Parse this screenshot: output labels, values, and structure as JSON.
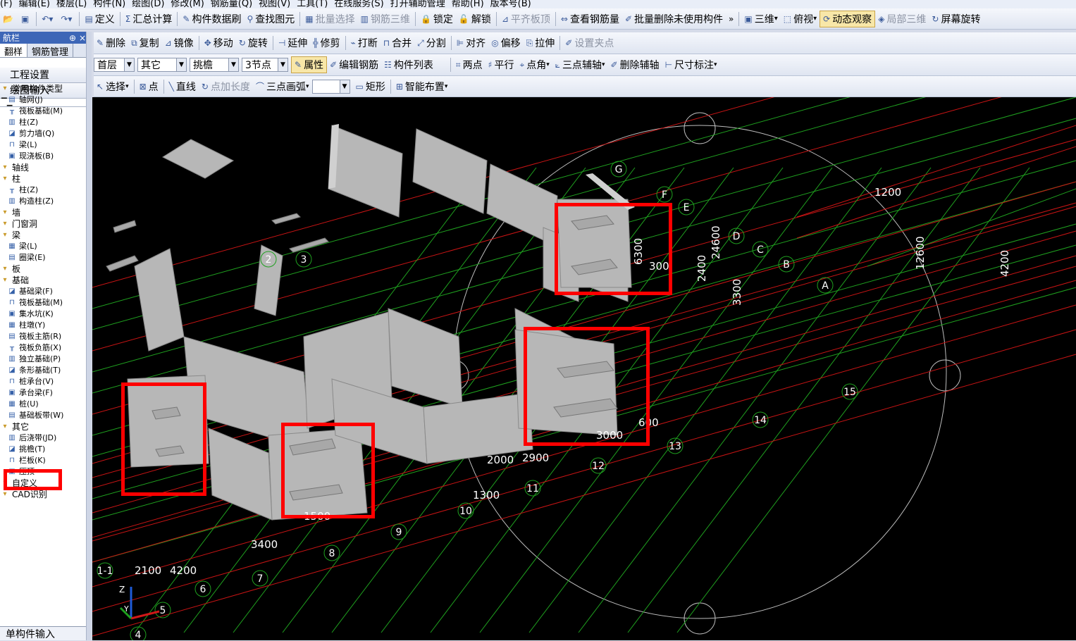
{
  "menu": [
    "(F)",
    "编辑(E)",
    "楼层(L)",
    "构件(N)",
    "绘图(D)",
    "修改(M)",
    "钢筋量(Q)",
    "视图(V)",
    "工具(T)",
    "在线服务(S)",
    "打开辅助管理",
    "帮助(H)",
    "版本号(B)"
  ],
  "toolbar1": {
    "items": [
      {
        "label": "定义",
        "icon": "define-icon"
      },
      {
        "label": "汇总计算",
        "icon": "sigma-icon"
      },
      {
        "label": "构件数据刷",
        "icon": "brush-icon"
      },
      {
        "label": "查找图元",
        "icon": "binoculars-icon"
      },
      {
        "label": "批量选择",
        "icon": "batch-select-icon",
        "disabled": true
      },
      {
        "label": "钢筋三维",
        "icon": "rebar-3d-icon",
        "disabled": true
      },
      {
        "label": "锁定",
        "icon": "lock-icon"
      },
      {
        "label": "解锁",
        "icon": "unlock-icon"
      },
      {
        "label": "平齐板顶",
        "icon": "align-top-icon",
        "disabled": true
      },
      {
        "label": "查看钢筋量",
        "icon": "view-rebar-icon"
      },
      {
        "label": "批量删除未使用构件",
        "icon": "batch-delete-icon"
      }
    ],
    "view_items": [
      {
        "label": "三维",
        "icon": "cube-icon"
      },
      {
        "label": "俯视",
        "icon": "topview-icon"
      },
      {
        "label": "动态观察",
        "icon": "orbit-icon",
        "active": true
      },
      {
        "label": "局部三维",
        "icon": "local-3d-icon",
        "disabled": true
      },
      {
        "label": "屏幕旋转",
        "icon": "rotate-screen-icon"
      }
    ]
  },
  "toolbar2": [
    {
      "label": "删除",
      "icon": "delete-icon"
    },
    {
      "label": "复制",
      "icon": "copy-icon"
    },
    {
      "label": "镜像",
      "icon": "mirror-icon"
    },
    {
      "label": "移动",
      "icon": "move-icon"
    },
    {
      "label": "旋转",
      "icon": "rotate-icon"
    },
    {
      "label": "延伸",
      "icon": "extend-icon"
    },
    {
      "label": "修剪",
      "icon": "trim-icon"
    },
    {
      "label": "打断",
      "icon": "break-icon"
    },
    {
      "label": "合并",
      "icon": "merge-icon"
    },
    {
      "label": "分割",
      "icon": "split-icon"
    },
    {
      "label": "对齐",
      "icon": "align-icon"
    },
    {
      "label": "偏移",
      "icon": "offset-icon"
    },
    {
      "label": "拉伸",
      "icon": "stretch-icon"
    },
    {
      "label": "设置夹点",
      "icon": "grip-icon",
      "disabled": true
    }
  ],
  "toolbar3": {
    "floor": "首层",
    "category": "其它",
    "component": "挑檐",
    "node": "3节点",
    "buttons": [
      "属性",
      "编辑钢筋",
      "构件列表"
    ],
    "axis_tools": [
      "两点",
      "平行",
      "点角",
      "三点辅轴",
      "删除辅轴",
      "尺寸标注"
    ]
  },
  "toolbar4": [
    "选择",
    "点",
    "直线",
    "点加长度",
    "三点画弧",
    "矩形",
    "智能布置"
  ],
  "sidebar": {
    "title": "航栏",
    "pin": "⊕",
    "close": "×",
    "tabs": [
      "翻样",
      "钢筋管理"
    ],
    "buttons": [
      "工程设置",
      "绘图输入"
    ],
    "tree": [
      {
        "label": "常用构件类型",
        "cat": true,
        "lvl": 1
      },
      {
        "label": "轴网(J)",
        "lvl": 2
      },
      {
        "label": "筏板基础(M)",
        "lvl": 2
      },
      {
        "label": "柱(Z)",
        "lvl": 2
      },
      {
        "label": "剪力墙(Q)",
        "lvl": 2
      },
      {
        "label": "梁(L)",
        "lvl": 2
      },
      {
        "label": "现浇板(B)",
        "lvl": 2
      },
      {
        "label": "轴线",
        "cat": true,
        "lvl": 1
      },
      {
        "label": "柱",
        "cat": true,
        "lvl": 1
      },
      {
        "label": "柱(Z)",
        "lvl": 2
      },
      {
        "label": "构造柱(Z)",
        "lvl": 2
      },
      {
        "label": "墙",
        "cat": true,
        "lvl": 1
      },
      {
        "label": "门窗洞",
        "cat": true,
        "lvl": 1
      },
      {
        "label": "梁",
        "cat": true,
        "lvl": 1
      },
      {
        "label": "梁(L)",
        "lvl": 2
      },
      {
        "label": "圈梁(E)",
        "lvl": 2
      },
      {
        "label": "板",
        "cat": true,
        "lvl": 1
      },
      {
        "label": "基础",
        "cat": true,
        "lvl": 1
      },
      {
        "label": "基础梁(F)",
        "lvl": 2
      },
      {
        "label": "筏板基础(M)",
        "lvl": 2
      },
      {
        "label": "集水坑(K)",
        "lvl": 2
      },
      {
        "label": "柱墩(Y)",
        "lvl": 2
      },
      {
        "label": "筏板主筋(R)",
        "lvl": 2
      },
      {
        "label": "筏板负筋(X)",
        "lvl": 2
      },
      {
        "label": "独立基础(P)",
        "lvl": 2
      },
      {
        "label": "条形基础(T)",
        "lvl": 2
      },
      {
        "label": "桩承台(V)",
        "lvl": 2
      },
      {
        "label": "承台梁(F)",
        "lvl": 2
      },
      {
        "label": "桩(U)",
        "lvl": 2
      },
      {
        "label": "基础板带(W)",
        "lvl": 2
      },
      {
        "label": "其它",
        "cat": true,
        "lvl": 1
      },
      {
        "label": "后浇带(JD)",
        "lvl": 2
      },
      {
        "label": "挑檐(T)",
        "lvl": 2,
        "selected": true
      },
      {
        "label": "栏板(K)",
        "lvl": 2
      },
      {
        "label": "压顶",
        "lvl": 2
      },
      {
        "label": "自定义",
        "cat": true,
        "lvl": 1
      },
      {
        "label": "CAD识别",
        "cat": true,
        "lvl": 1
      }
    ],
    "bottom": "单构件输入"
  },
  "viewport": {
    "axis_labels": [
      "G",
      "F",
      "E",
      "D",
      "C",
      "B",
      "A",
      "1-1",
      "15",
      "14",
      "13",
      "12",
      "11",
      "10",
      "9",
      "8",
      "7",
      "6",
      "5",
      "4",
      "3",
      "2"
    ],
    "dims": [
      "2100",
      "4200",
      "3400",
      "3000",
      "600",
      "2900",
      "1300",
      "2000",
      "1500",
      "6300",
      "2400",
      "24600",
      "3300",
      "12600",
      "4200",
      "1200",
      "300"
    ]
  },
  "colors": {
    "highlight": "#ff0000",
    "grid_green": "#1fa01f",
    "grid_red": "#c81414",
    "wall": "#b9b9b9"
  }
}
